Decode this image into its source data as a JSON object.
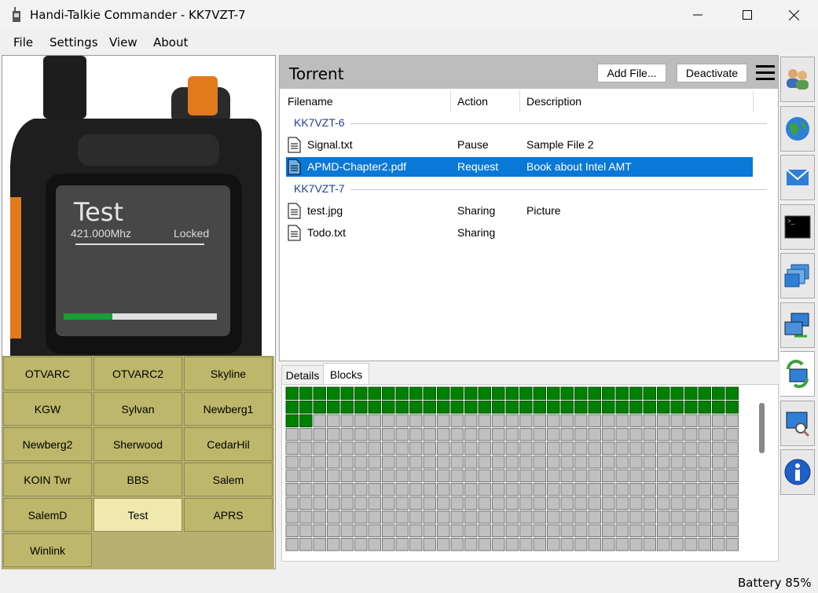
{
  "window": {
    "title": "Handi-Talkie Commander - KK7VZT-7"
  },
  "menu": [
    "File",
    "Settings",
    "View",
    "About"
  ],
  "radio_screen": {
    "channel": "Test",
    "frequency": "421.000Mhz",
    "lock": "Locked",
    "signal_level": 0.32
  },
  "channels": [
    "OTVARC",
    "OTVARC2",
    "Skyline",
    "KGW",
    "Sylvan",
    "Newberg1",
    "Newberg2",
    "Sherwood",
    "CedarHil",
    "KOIN Twr",
    "BBS",
    "Salem",
    "SalemD",
    "Test",
    "APRS",
    "Winlink"
  ],
  "active_channel": "Test",
  "torrent": {
    "title": "Torrent",
    "add_file": "Add File...",
    "deactivate": "Deactivate",
    "columns": [
      "Filename",
      "Action",
      "Description"
    ],
    "groups": [
      {
        "name": "KK7VZT-6",
        "files": [
          {
            "name": "Signal.txt",
            "action": "Pause",
            "description": "Sample File 2",
            "selected": false
          },
          {
            "name": "APMD-Chapter2.pdf",
            "action": "Request",
            "description": "Book about Intel AMT",
            "selected": true
          }
        ]
      },
      {
        "name": "KK7VZT-7",
        "files": [
          {
            "name": "test.jpg",
            "action": "Sharing",
            "description": "Picture",
            "selected": false
          },
          {
            "name": "Todo.txt",
            "action": "Sharing",
            "description": "",
            "selected": false
          }
        ]
      }
    ]
  },
  "tabs": [
    "Details",
    "Blocks"
  ],
  "active_tab": "Blocks",
  "blocks": {
    "total": 396,
    "complete_count": 69,
    "missing_index": 2,
    "complete_color": "#008000",
    "empty_color": "#c0c0c0"
  },
  "sidebar_icons": [
    "contacts-icon",
    "globe-icon",
    "mail-icon",
    "terminal-icon",
    "windows-icon",
    "network-icon",
    "sync-icon",
    "search-computer-icon",
    "info-icon"
  ],
  "status": {
    "battery": "Battery 85%"
  }
}
